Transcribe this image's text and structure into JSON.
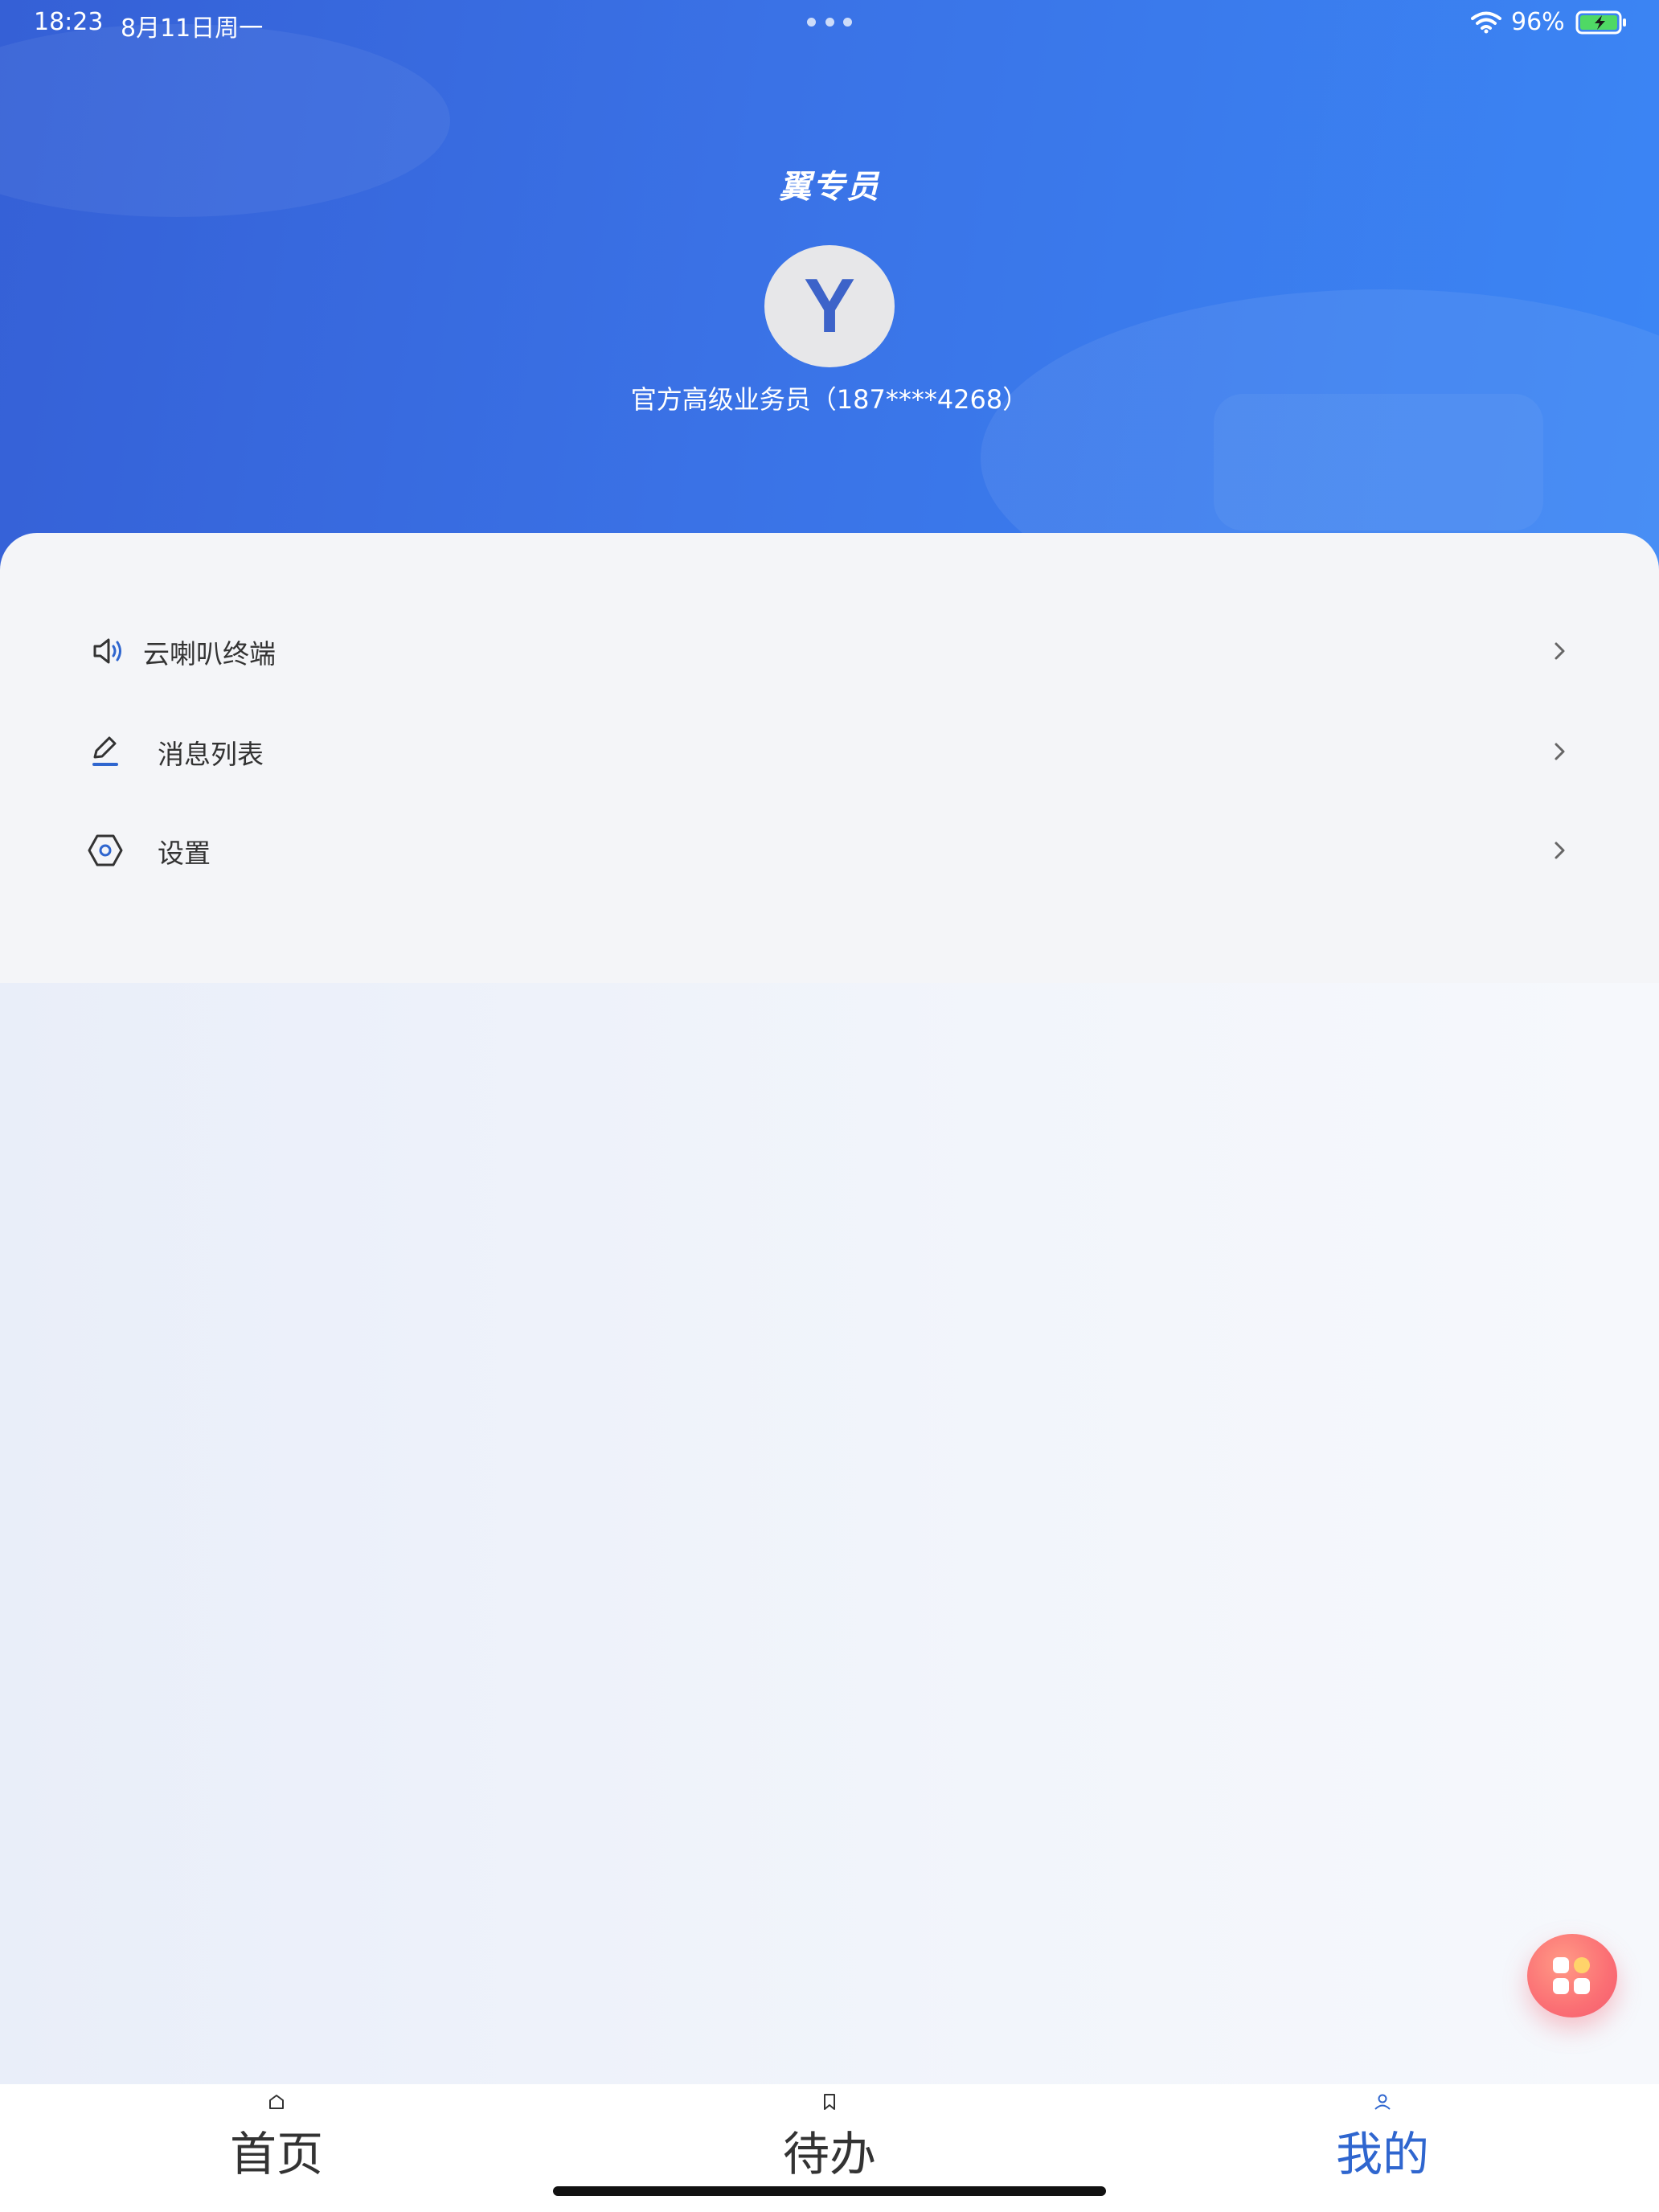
{
  "status_bar": {
    "time": "18:23",
    "date": "8月11日周一",
    "battery": "96%"
  },
  "header": {
    "app_title": "翼专员",
    "avatar_letter": "Y",
    "user_info": "官方高级业务员（187****4268）"
  },
  "menu": {
    "items": [
      {
        "label": "云喇叭终端",
        "icon": "speaker-icon"
      },
      {
        "label": "消息列表",
        "icon": "edit-pen-icon"
      },
      {
        "label": "设置",
        "icon": "settings-hexagon-icon"
      }
    ]
  },
  "tabs": [
    {
      "label": "首页",
      "icon": "home-icon",
      "active": false
    },
    {
      "label": "待办",
      "icon": "bookmark-icon",
      "active": false
    },
    {
      "label": "我的",
      "icon": "user-icon",
      "active": true
    }
  ],
  "colors": {
    "primary": "#2f66cf",
    "header_start": "#3560d6",
    "header_end": "#3b86f5",
    "fab": "#f45b6e"
  }
}
